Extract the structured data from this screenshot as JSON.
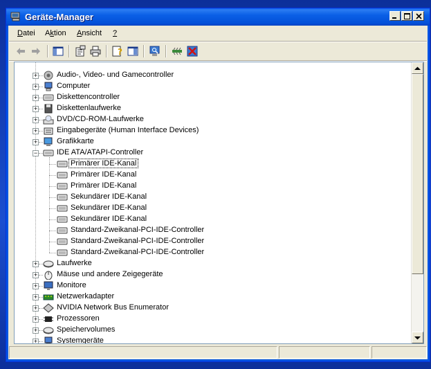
{
  "window": {
    "title": "Geräte-Manager",
    "accent": "#0054e3"
  },
  "menu": [
    {
      "label": "Datei",
      "underline": "D"
    },
    {
      "label": "Aktion",
      "underline": "k"
    },
    {
      "label": "Ansicht",
      "underline": "A"
    },
    {
      "label": "?",
      "underline": "?"
    }
  ],
  "toolbar": {
    "buttons": [
      "back-arrow-icon",
      "forward-arrow-icon",
      "show-hide-tree-icon",
      "properties-icon",
      "print-icon",
      "help-icon",
      "show-pane-icon",
      "scan-hardware-icon",
      "disable-device-icon",
      "uninstall-device-icon"
    ]
  },
  "tree": {
    "top_partial": "",
    "items": [
      {
        "label": "Audio-, Video- und Gamecontroller",
        "icon": "audio-icon",
        "level": 0,
        "expanded": false
      },
      {
        "label": "Computer",
        "icon": "computer-icon",
        "level": 0,
        "expanded": false
      },
      {
        "label": "Diskettencontroller",
        "icon": "controller-icon",
        "level": 0,
        "expanded": false
      },
      {
        "label": "Diskettenlaufwerke",
        "icon": "floppy-icon",
        "level": 0,
        "expanded": false
      },
      {
        "label": "DVD/CD-ROM-Laufwerke",
        "icon": "cdrom-icon",
        "level": 0,
        "expanded": false
      },
      {
        "label": "Eingabegeräte (Human Interface Devices)",
        "icon": "hid-icon",
        "level": 0,
        "expanded": false
      },
      {
        "label": "Grafikkarte",
        "icon": "display-adapter-icon",
        "level": 0,
        "expanded": false
      },
      {
        "label": "IDE ATA/ATAPI-Controller",
        "icon": "controller-icon",
        "level": 0,
        "expanded": true
      },
      {
        "label": "Primärer IDE-Kanal",
        "icon": "controller-icon",
        "level": 1,
        "selected": true
      },
      {
        "label": "Primärer IDE-Kanal",
        "icon": "controller-icon",
        "level": 1
      },
      {
        "label": "Primärer IDE-Kanal",
        "icon": "controller-icon",
        "level": 1
      },
      {
        "label": "Sekundärer IDE-Kanal",
        "icon": "controller-icon",
        "level": 1
      },
      {
        "label": "Sekundärer IDE-Kanal",
        "icon": "controller-icon",
        "level": 1
      },
      {
        "label": "Sekundärer IDE-Kanal",
        "icon": "controller-icon",
        "level": 1
      },
      {
        "label": "Standard-Zweikanal-PCI-IDE-Controller",
        "icon": "controller-icon",
        "level": 1
      },
      {
        "label": "Standard-Zweikanal-PCI-IDE-Controller",
        "icon": "controller-icon",
        "level": 1
      },
      {
        "label": "Standard-Zweikanal-PCI-IDE-Controller",
        "icon": "controller-icon",
        "level": 1
      },
      {
        "label": "Laufwerke",
        "icon": "drive-icon",
        "level": 0,
        "expanded": false
      },
      {
        "label": "Mäuse und andere Zeigegeräte",
        "icon": "mouse-icon",
        "level": 0,
        "expanded": false
      },
      {
        "label": "Monitore",
        "icon": "monitor-icon",
        "level": 0,
        "expanded": false
      },
      {
        "label": "Netzwerkadapter",
        "icon": "network-icon",
        "level": 0,
        "expanded": false
      },
      {
        "label": "NVIDIA Network Bus Enumerator",
        "icon": "bus-icon",
        "level": 0,
        "expanded": false
      },
      {
        "label": "Prozessoren",
        "icon": "cpu-icon",
        "level": 0,
        "expanded": false
      },
      {
        "label": "Speichervolumes",
        "icon": "drive-icon",
        "level": 0,
        "expanded": false
      },
      {
        "label": "Systemgeräte",
        "icon": "computer-icon",
        "level": 0,
        "expanded": false
      }
    ]
  }
}
